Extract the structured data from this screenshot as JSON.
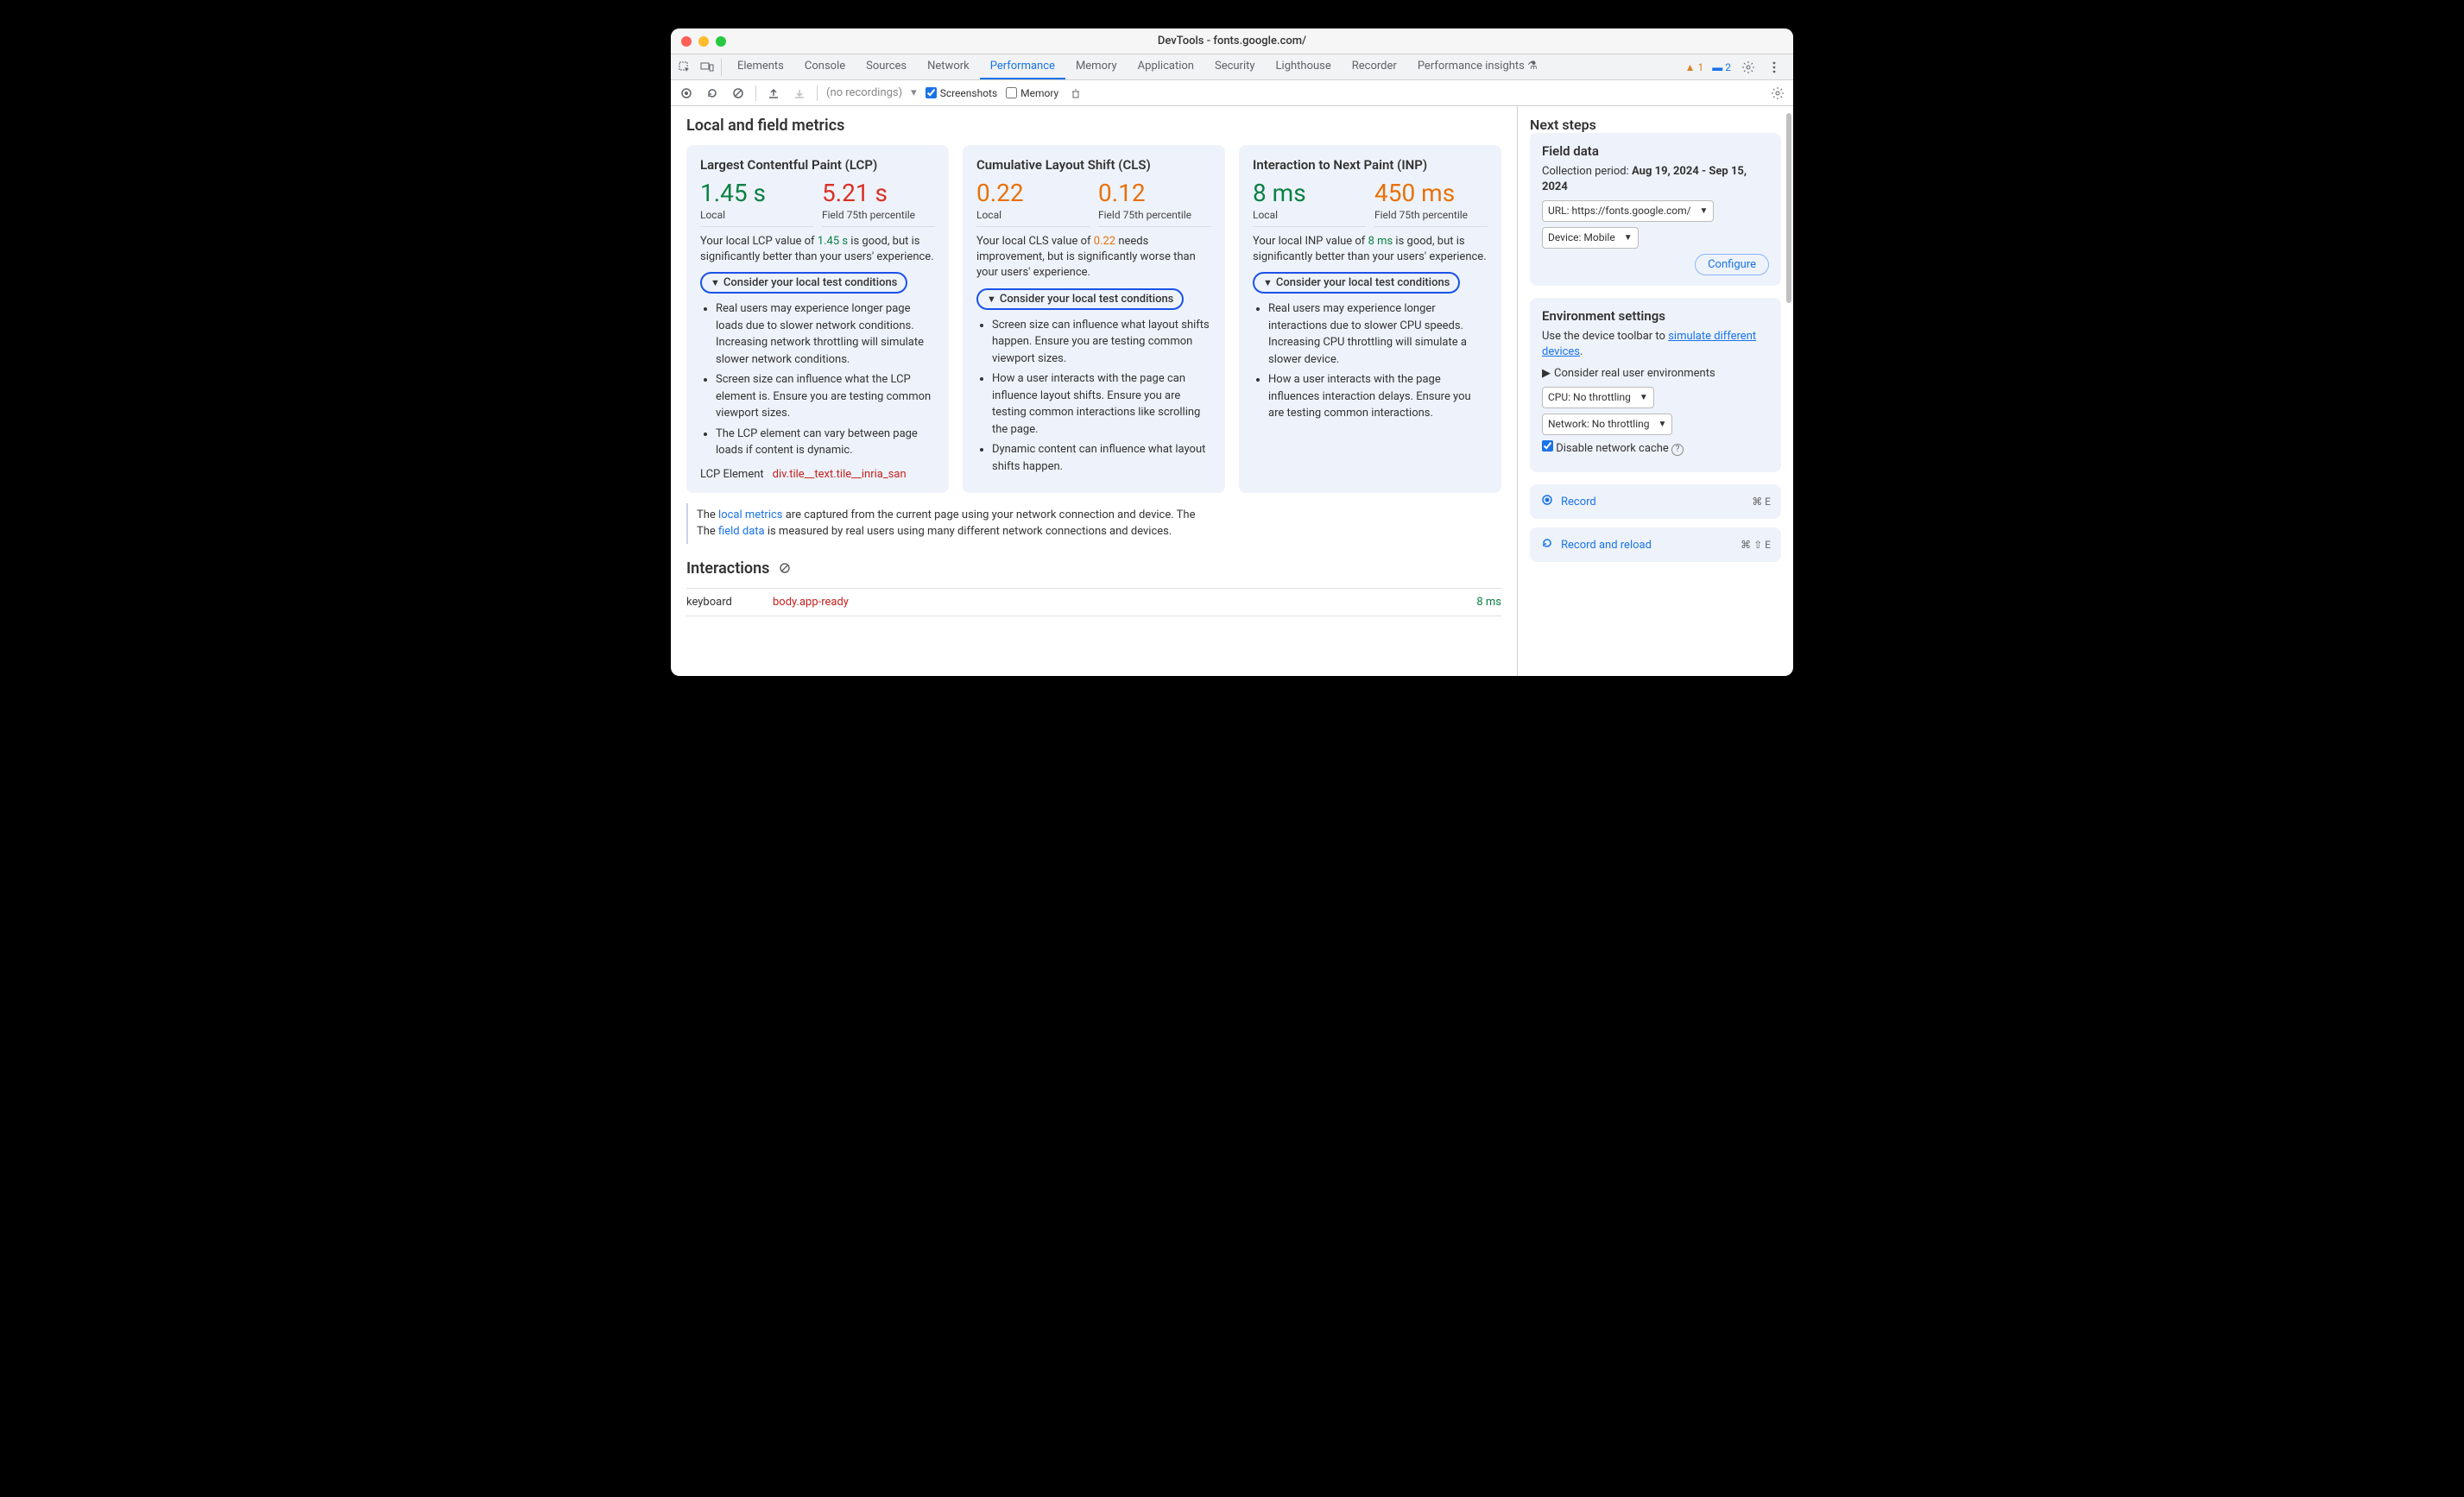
{
  "window_title": "DevTools - fonts.google.com/",
  "tabs": [
    "Elements",
    "Console",
    "Sources",
    "Network",
    "Performance",
    "Memory",
    "Application",
    "Security",
    "Lighthouse",
    "Recorder",
    "Performance insights"
  ],
  "active_tab": "Performance",
  "warnings_count": "1",
  "messages_count": "2",
  "recordings_placeholder": "(no recordings)",
  "checkbox_screenshots": "Screenshots",
  "checkbox_memory": "Memory",
  "main_heading": "Local and field metrics",
  "cards": {
    "lcp": {
      "title": "Largest Contentful Paint (LCP)",
      "local_value": "1.45 s",
      "field_value": "5.21 s",
      "desc_pre": "Your local LCP value of ",
      "desc_val": "1.45 s",
      "desc_post": " is good, but is significantly better than your users' experience.",
      "bullets": [
        "Real users may experience longer page loads due to slower network conditions. Increasing network throttling will simulate slower network conditions.",
        "Screen size can influence what the LCP element is. Ensure you are testing common viewport sizes.",
        "The LCP element can vary between page loads if content is dynamic."
      ],
      "elem_label": "LCP Element",
      "elem_val": "div.tile__text.tile__inria_san"
    },
    "cls": {
      "title": "Cumulative Layout Shift (CLS)",
      "local_value": "0.22",
      "field_value": "0.12",
      "desc_pre": "Your local CLS value of ",
      "desc_val": "0.22",
      "desc_post": " needs improvement, but is significantly worse than your users' experience.",
      "bullets": [
        "Screen size can influence what layout shifts happen. Ensure you are testing common viewport sizes.",
        "How a user interacts with the page can influence layout shifts. Ensure you are testing common interactions like scrolling the page.",
        "Dynamic content can influence what layout shifts happen."
      ]
    },
    "inp": {
      "title": "Interaction to Next Paint (INP)",
      "local_value": "8 ms",
      "field_value": "450 ms",
      "desc_pre": "Your local INP value of ",
      "desc_val": "8 ms",
      "desc_post": " is good, but is significantly better than your users' experience.",
      "bullets": [
        "Real users may experience longer interactions due to slower CPU speeds. Increasing CPU throttling will simulate a slower device.",
        "How a user interacts with the page influences interaction delays. Ensure you are testing common interactions."
      ]
    }
  },
  "local_label": "Local",
  "field_label": "Field 75th percentile",
  "disclosure_label": "Consider your local test conditions",
  "footnote_pre": "The ",
  "footnote_link1": "local metrics",
  "footnote_mid": " are captured from the current page using your network connection and device. The ",
  "footnote_link2": "field data",
  "footnote_post": " is measured by real users using many different network connections and devices.",
  "interactions_heading": "Interactions",
  "interaction": {
    "name": "keyboard",
    "target": "body.app-ready",
    "time": "8 ms"
  },
  "side": {
    "next_steps": "Next steps",
    "field_data_title": "Field data",
    "collection_label": "Collection period: ",
    "collection_value": "Aug 19, 2024 - Sep 15, 2024",
    "url_select": "URL: https://fonts.google.com/",
    "device_select": "Device: Mobile",
    "configure": "Configure",
    "env_title": "Environment settings",
    "env_desc_pre": "Use the device toolbar to ",
    "env_link": "simulate different devices",
    "env_disclosure": "Consider real user environments",
    "cpu_select": "CPU: No throttling",
    "net_select": "Network: No throttling",
    "disable_cache": "Disable network cache",
    "record": "Record",
    "record_shortcut": "⌘ E",
    "record_reload": "Record and reload",
    "record_reload_shortcut": "⌘ ⇧ E"
  }
}
